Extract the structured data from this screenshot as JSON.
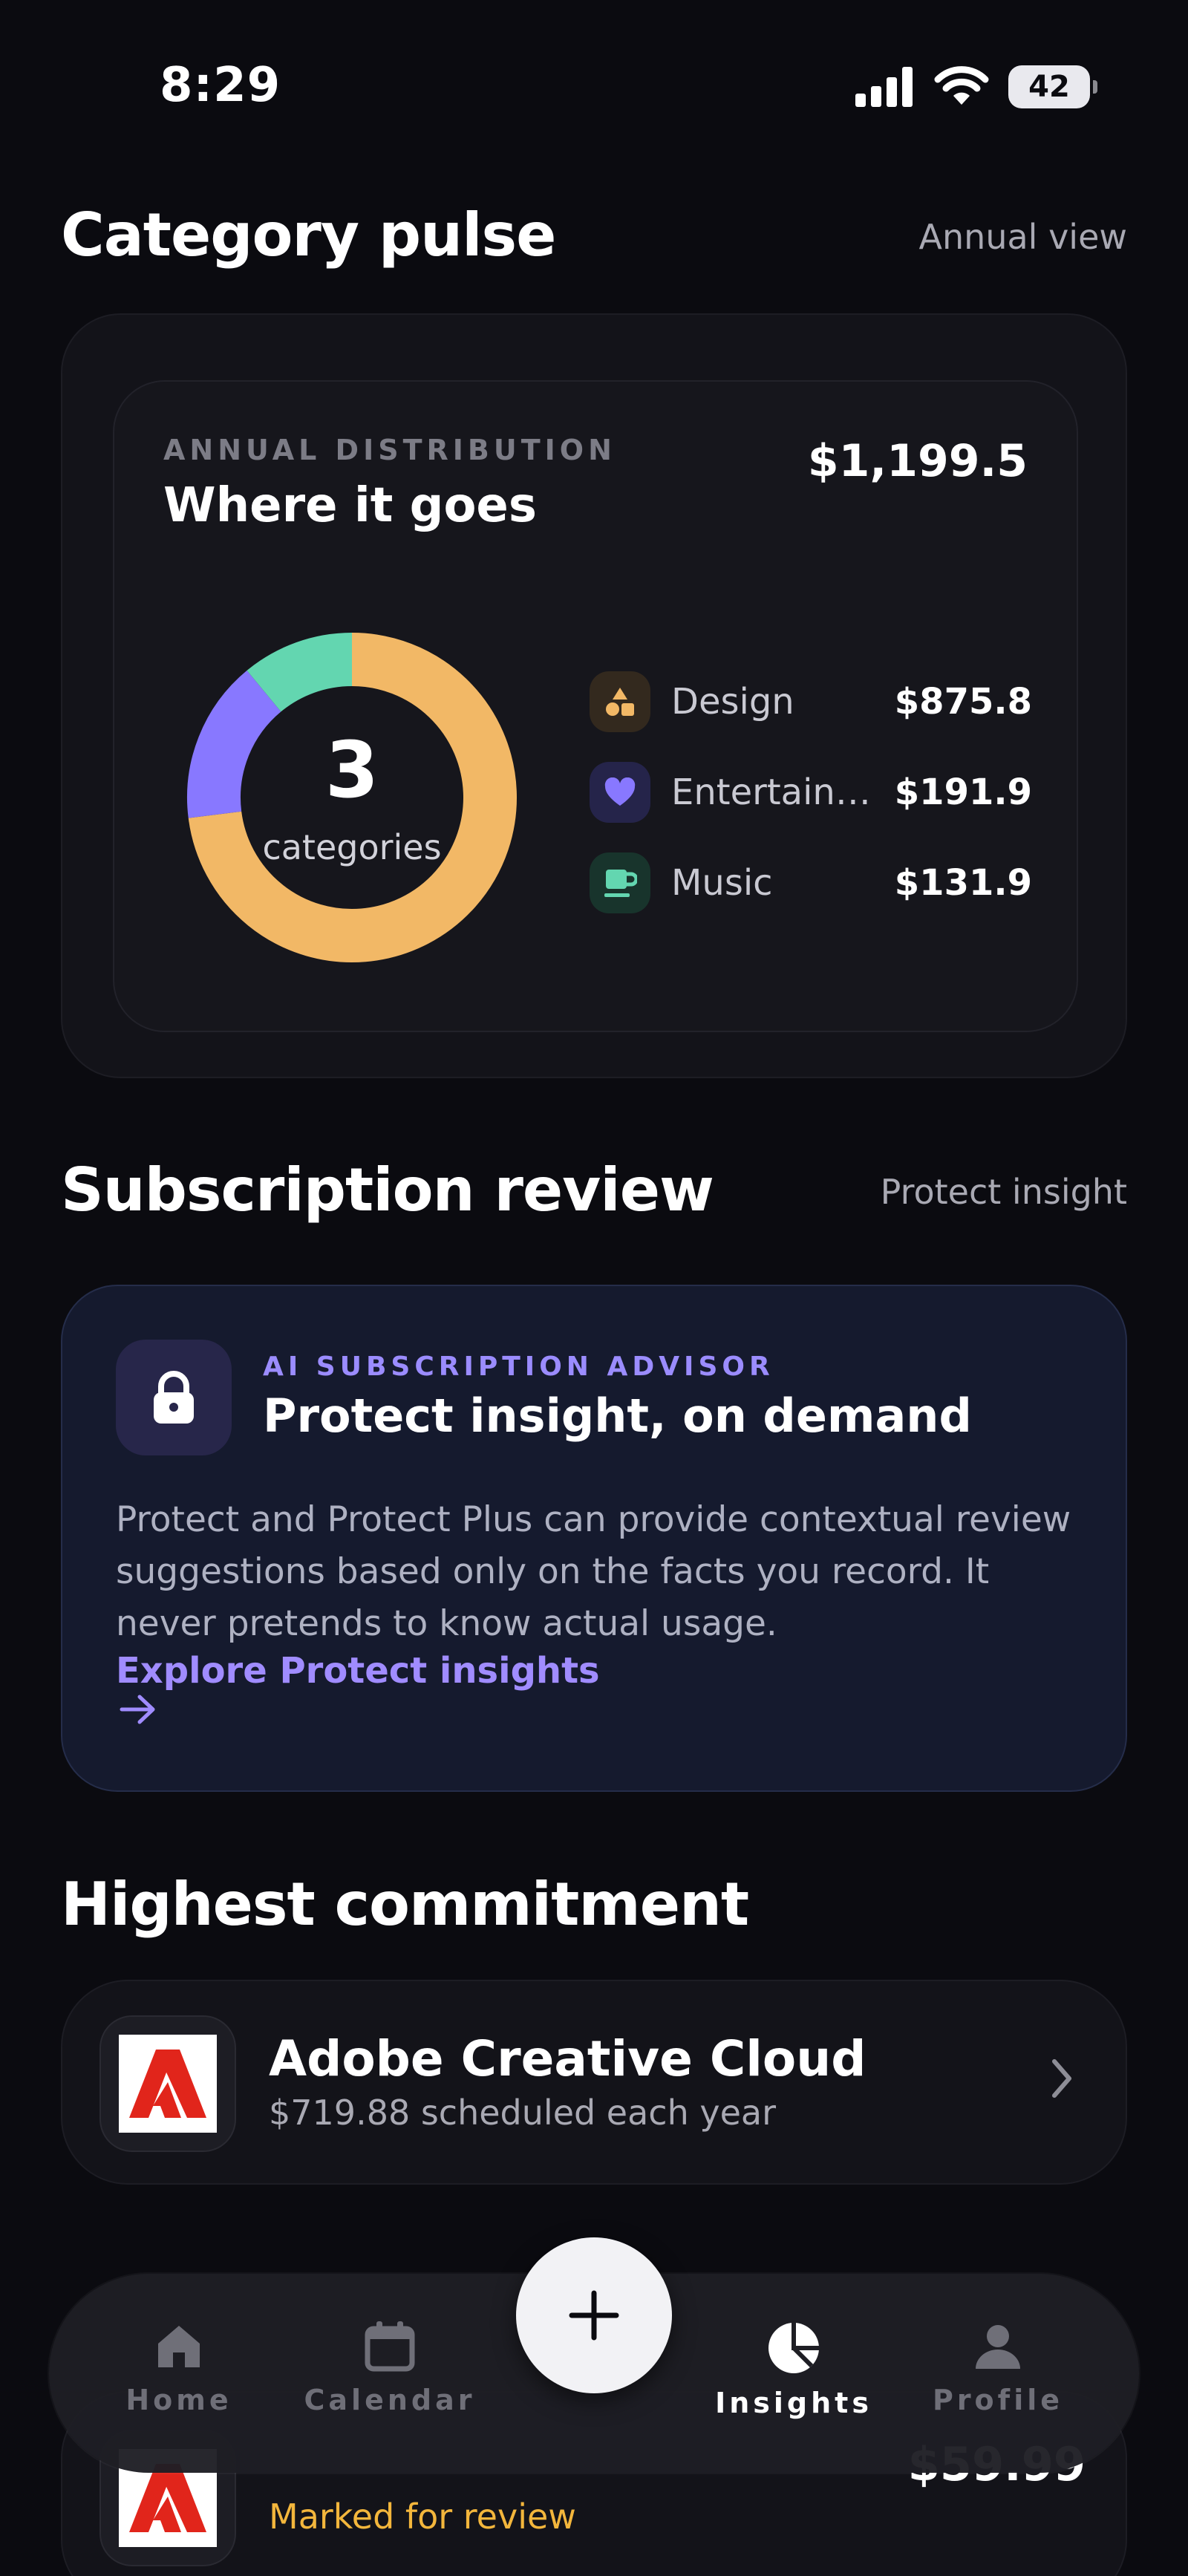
{
  "status_bar": {
    "time": "8:29",
    "battery": "42"
  },
  "category_pulse": {
    "title": "Category pulse",
    "view_link": "Annual view",
    "card": {
      "eyebrow": "ANNUAL DISTRIBUTION",
      "heading": "Where it goes",
      "total": "$1,199.5",
      "center_count": "3",
      "center_label": "categories",
      "legend": [
        {
          "name": "Design",
          "value": "$875.8",
          "icon": "shapes-icon",
          "color": "#f2b866"
        },
        {
          "name": "Entertainm...",
          "value": "$191.9",
          "icon": "heart-icon",
          "color": "#8878ff"
        },
        {
          "name": "Music",
          "value": "$131.9",
          "icon": "cup-icon",
          "color": "#63d6b0"
        }
      ]
    }
  },
  "chart_data": {
    "type": "pie",
    "categories": [
      "Design",
      "Entertainm...",
      "Music"
    ],
    "values": [
      875.8,
      191.9,
      131.9
    ],
    "colors": [
      "#f2b866",
      "#8878ff",
      "#63d6b0"
    ]
  },
  "subscription_review": {
    "title": "Subscription review",
    "link": "Protect insight",
    "advisor": {
      "eyebrow": "AI SUBSCRIPTION ADVISOR",
      "title": "Protect insight, on demand",
      "body": "Protect and Protect Plus can provide contextual review suggestions based only on the facts you record. It never pretends to know actual usage.",
      "cta": "Explore Protect insights"
    }
  },
  "highest_commitment": {
    "title": "Highest commitment",
    "item": {
      "name": "Adobe Creative Cloud",
      "subtitle": "$719.88 scheduled each year"
    }
  },
  "next_section": {
    "item": {
      "status": "Marked for review",
      "price": "$59.99"
    }
  },
  "tab_bar": {
    "tabs": [
      {
        "label": "Home",
        "icon": "home-icon"
      },
      {
        "label": "Calendar",
        "icon": "calendar-icon"
      },
      {
        "label": "Insights",
        "icon": "pie-chart-icon",
        "active": true
      },
      {
        "label": "Profile",
        "icon": "person-icon"
      }
    ],
    "fab_icon": "plus-icon"
  }
}
